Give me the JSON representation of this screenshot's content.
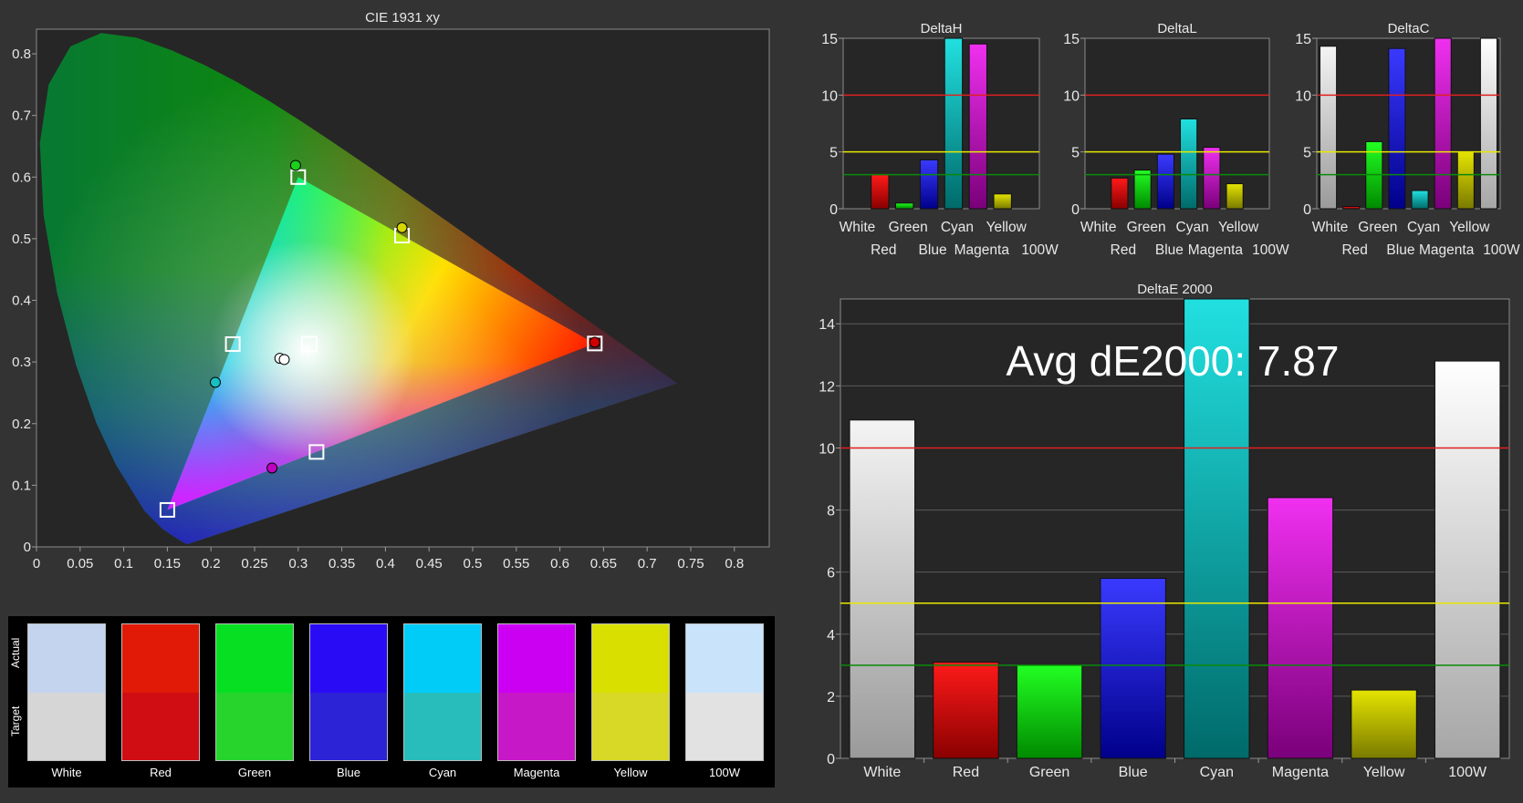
{
  "cie": {
    "title": "CIE 1931 xy",
    "x_ticks": [
      "0",
      "0.05",
      "0.1",
      "0.15",
      "0.2",
      "0.25",
      "0.3",
      "0.35",
      "0.4",
      "0.45",
      "0.5",
      "0.55",
      "0.6",
      "0.65",
      "0.7",
      "0.75",
      "0.8"
    ],
    "y_ticks": [
      "0",
      "0.1",
      "0.2",
      "0.3",
      "0.4",
      "0.5",
      "0.6",
      "0.7",
      "0.8"
    ]
  },
  "swatches": {
    "actual_label": "Actual",
    "target_label": "Target",
    "items": [
      {
        "label": "White",
        "actual": "#c4d4ef",
        "target": "#d6d6d6"
      },
      {
        "label": "Red",
        "actual": "#e01a07",
        "target": "#cf0d12"
      },
      {
        "label": "Green",
        "actual": "#07e022",
        "target": "#27d42c"
      },
      {
        "label": "Blue",
        "actual": "#2a0bf5",
        "target": "#2c22d6"
      },
      {
        "label": "Cyan",
        "actual": "#00ccf7",
        "target": "#28bdbb"
      },
      {
        "label": "Magenta",
        "actual": "#cb00f3",
        "target": "#c718c8"
      },
      {
        "label": "Yellow",
        "actual": "#d9e000",
        "target": "#d8d926"
      },
      {
        "label": "100W",
        "actual": "#c9e3fb",
        "target": "#e2e2e2"
      }
    ]
  },
  "small_charts": {
    "top_labels": [
      "White",
      "Green",
      "Cyan",
      "Yellow"
    ],
    "bottom_labels": [
      "Red",
      "Blue",
      "Magenta",
      "100W"
    ],
    "y_ticks": [
      "0",
      "5",
      "10",
      "15"
    ]
  },
  "big_chart": {
    "title": "DeltaE 2000",
    "avg_text": "Avg dE2000: 7.87",
    "y_ticks": [
      "0",
      "2",
      "4",
      "6",
      "8",
      "10",
      "12",
      "14"
    ]
  },
  "chart_data": [
    {
      "type": "scatter",
      "title": "CIE 1931 xy",
      "xlim": [
        0,
        0.84
      ],
      "ylim": [
        0,
        0.84
      ],
      "gamut_target": [
        [
          0.64,
          0.33
        ],
        [
          0.3,
          0.6
        ],
        [
          0.15,
          0.06
        ]
      ],
      "targets": [
        {
          "name": "White",
          "x": 0.3127,
          "y": 0.329
        },
        {
          "name": "Red",
          "x": 0.64,
          "y": 0.33
        },
        {
          "name": "Green",
          "x": 0.3,
          "y": 0.6
        },
        {
          "name": "Blue",
          "x": 0.15,
          "y": 0.06
        },
        {
          "name": "Cyan",
          "x": 0.225,
          "y": 0.329
        },
        {
          "name": "Magenta",
          "x": 0.321,
          "y": 0.154
        },
        {
          "name": "Yellow",
          "x": 0.419,
          "y": 0.505
        }
      ],
      "measured": [
        {
          "name": "White",
          "x": 0.279,
          "y": 0.306,
          "color": "#ffffff"
        },
        {
          "name": "100W",
          "x": 0.284,
          "y": 0.304,
          "color": "#ffffff"
        },
        {
          "name": "Green",
          "x": 0.297,
          "y": 0.619,
          "color": "#1bd01b"
        },
        {
          "name": "Yellow",
          "x": 0.419,
          "y": 0.518,
          "color": "#d6d600"
        },
        {
          "name": "Cyan",
          "x": 0.205,
          "y": 0.267,
          "color": "#18c0c0"
        },
        {
          "name": "Magenta",
          "x": 0.27,
          "y": 0.128,
          "color": "#c000c0"
        },
        {
          "name": "Red",
          "x": 0.64,
          "y": 0.332,
          "color": "#d00000"
        }
      ]
    },
    {
      "type": "bar",
      "title": "DeltaH",
      "categories": [
        "White",
        "Red",
        "Green",
        "Blue",
        "Cyan",
        "Magenta",
        "Yellow",
        "100W"
      ],
      "values": [
        0,
        3.0,
        0.5,
        4.3,
        15,
        14.5,
        1.3,
        0
      ],
      "ylim": [
        0,
        15
      ],
      "thresholds": [
        3,
        5,
        10
      ]
    },
    {
      "type": "bar",
      "title": "DeltaL",
      "categories": [
        "White",
        "Red",
        "Green",
        "Blue",
        "Cyan",
        "Magenta",
        "Yellow",
        "100W"
      ],
      "values": [
        0,
        2.7,
        3.4,
        4.8,
        7.9,
        5.4,
        2.2,
        0
      ],
      "ylim": [
        0,
        15
      ],
      "thresholds": [
        3,
        5,
        10
      ]
    },
    {
      "type": "bar",
      "title": "DeltaC",
      "categories": [
        "White",
        "Red",
        "Green",
        "Blue",
        "Cyan",
        "Magenta",
        "Yellow",
        "100W"
      ],
      "values": [
        14.3,
        0.2,
        5.9,
        14.1,
        1.6,
        15,
        5.0,
        15
      ],
      "ylim": [
        0,
        15
      ],
      "thresholds": [
        3,
        5,
        10
      ]
    },
    {
      "type": "bar",
      "title": "DeltaE 2000",
      "categories": [
        "White",
        "Red",
        "Green",
        "Blue",
        "Cyan",
        "Magenta",
        "Yellow",
        "100W"
      ],
      "values": [
        10.9,
        3.1,
        3.0,
        5.8,
        15,
        8.4,
        2.2,
        12.8
      ],
      "ylim": [
        0,
        14.8
      ],
      "thresholds": [
        3,
        5,
        10
      ]
    }
  ],
  "colors": {
    "background": "#333333",
    "plot_bg": "#262626",
    "threshold_10": "#e02020",
    "threshold_5": "#e8e800",
    "threshold_3": "#0a8a0a",
    "bar_fills": [
      [
        "#f4f4f4",
        "#9a9a9a"
      ],
      [
        "#ff1a1a",
        "#8a0000"
      ],
      [
        "#22ff22",
        "#008a00"
      ],
      [
        "#3a3aff",
        "#00008a"
      ],
      [
        "#22e0e0",
        "#006a6a"
      ],
      [
        "#f030f0",
        "#7a007a"
      ],
      [
        "#e4e400",
        "#7a7a00"
      ],
      [
        "#ffffff",
        "#a6a6a6"
      ]
    ]
  }
}
